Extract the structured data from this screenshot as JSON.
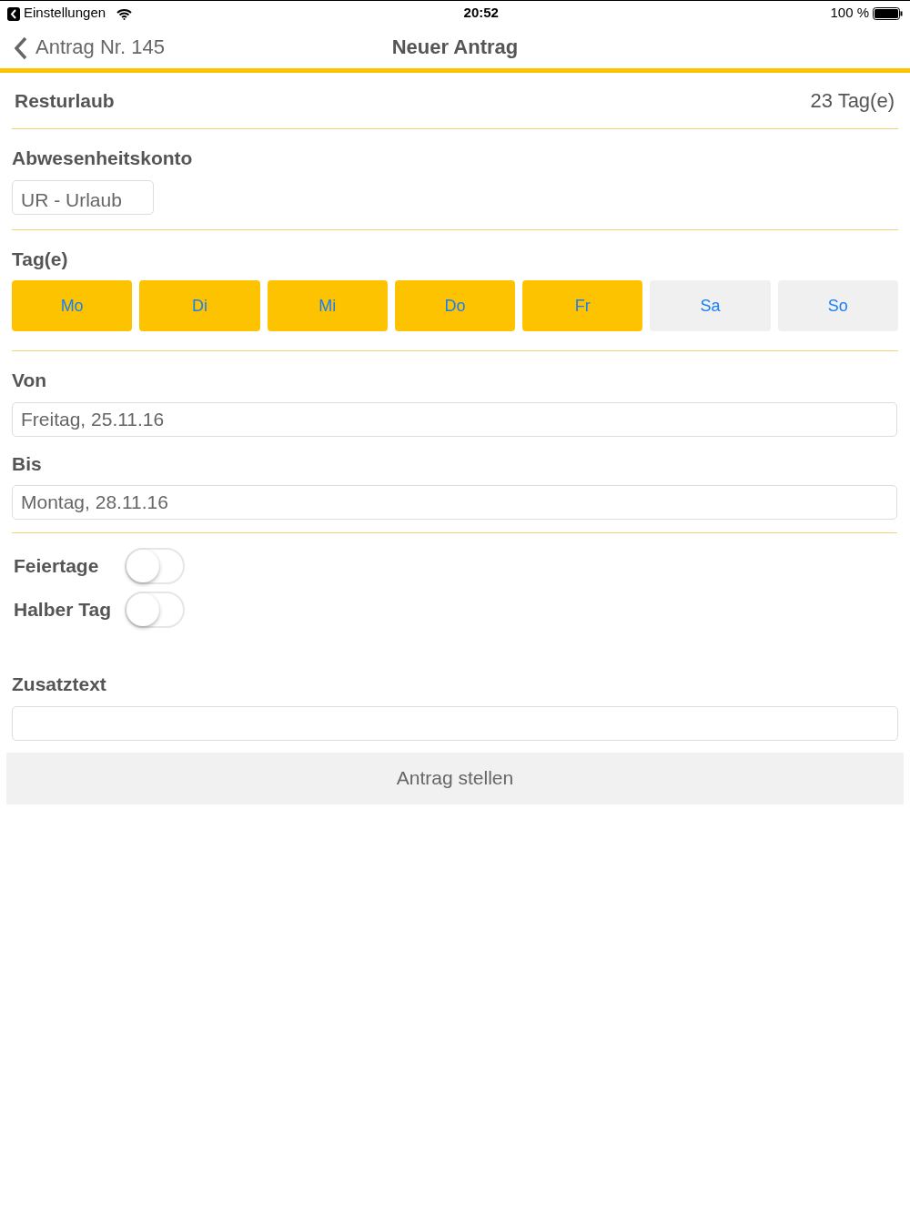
{
  "status_bar": {
    "back_app": "Einstellungen",
    "time": "20:52",
    "battery": "100 %"
  },
  "nav": {
    "back": "Antrag Nr. 145",
    "title": "Neuer Antrag"
  },
  "remaining": {
    "label": "Resturlaub",
    "value": "23 Tag(e)"
  },
  "account": {
    "label": "Abwesenheitskonto",
    "value": "UR - Urlaub"
  },
  "days": {
    "label": "Tag(e)",
    "items": [
      {
        "label": "Mo",
        "selected": true
      },
      {
        "label": "Di",
        "selected": true
      },
      {
        "label": "Mi",
        "selected": true
      },
      {
        "label": "Do",
        "selected": true
      },
      {
        "label": "Fr",
        "selected": true
      },
      {
        "label": "Sa",
        "selected": false
      },
      {
        "label": "So",
        "selected": false
      }
    ]
  },
  "from": {
    "label": "Von",
    "value": "Freitag, 25.11.16"
  },
  "to": {
    "label": "Bis",
    "value": "Montag, 28.11.16"
  },
  "toggles": [
    {
      "label": "Feiertage",
      "on": false
    },
    {
      "label": "Halber Tag",
      "on": false
    }
  ],
  "extra": {
    "label": "Zusatztext"
  },
  "submit": "Antrag stellen"
}
